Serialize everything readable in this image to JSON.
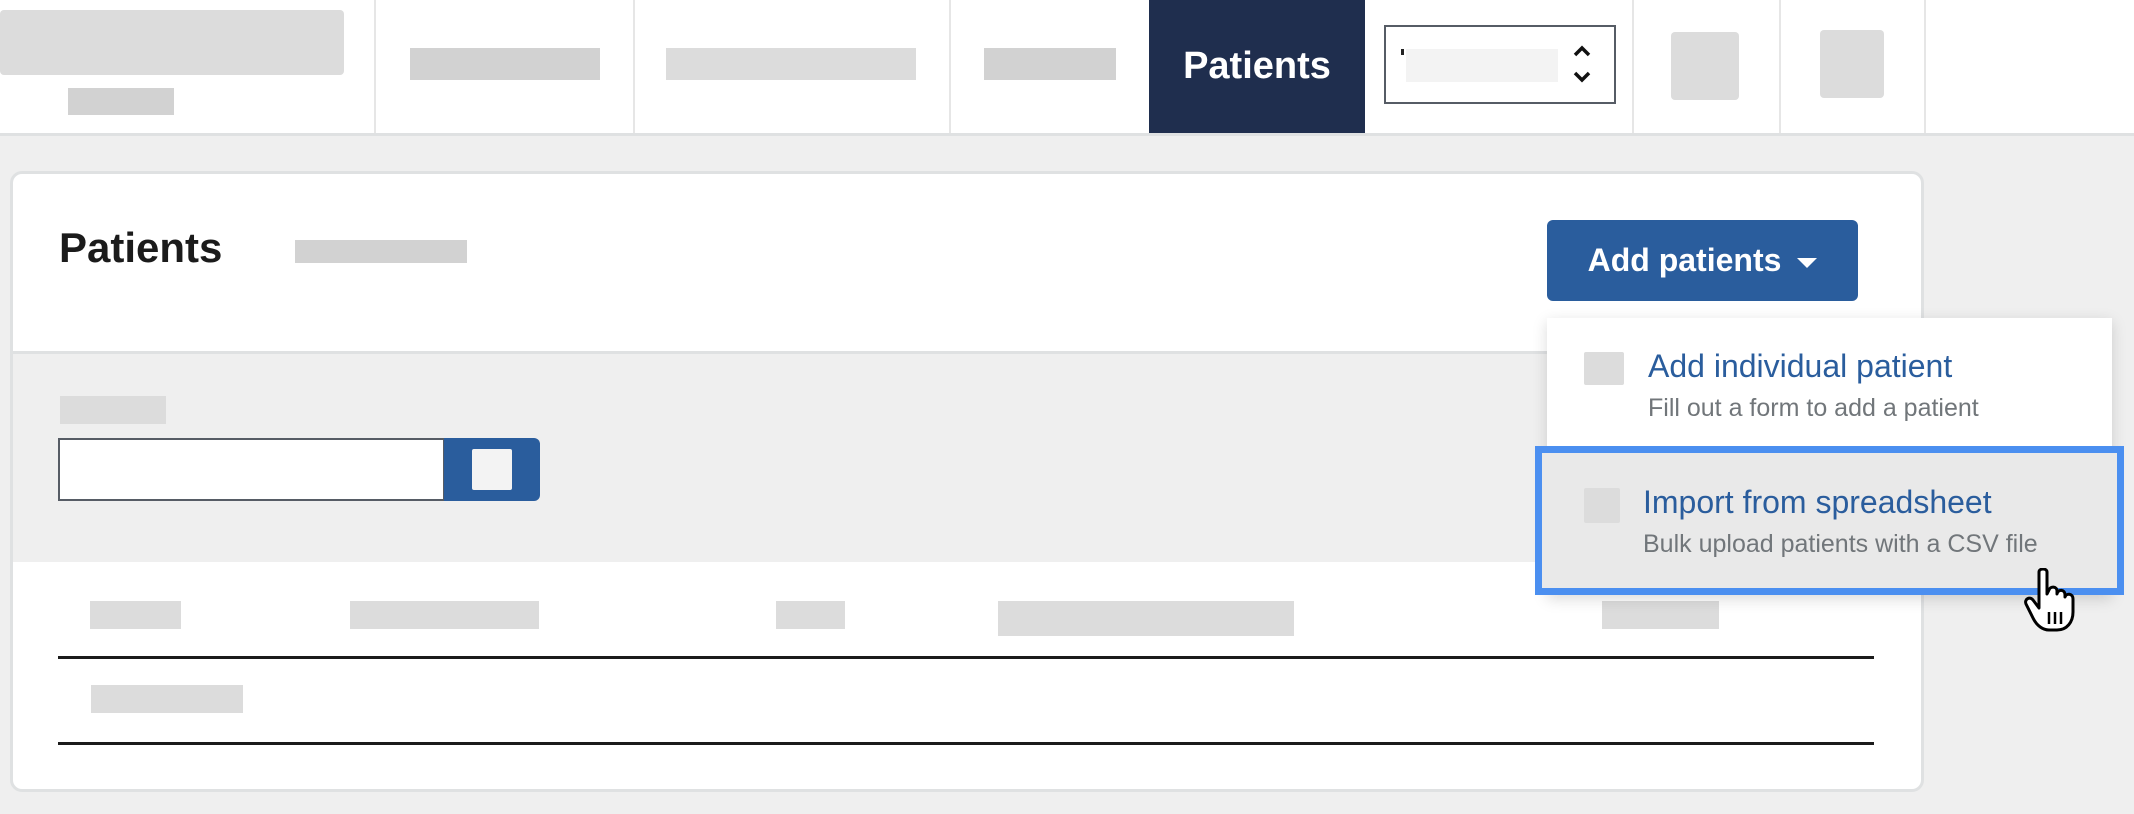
{
  "nav": {
    "active_tab_label": "Patients",
    "select": {
      "value": "",
      "icon": "up-down-chevron-icon"
    },
    "icon_buttons": [
      "icon-button-1",
      "icon-button-2"
    ]
  },
  "card": {
    "title": "Patients",
    "add_button": {
      "label": "Add patients",
      "icon": "caret-down-icon"
    },
    "search": {
      "value": "",
      "placeholder": "",
      "button_icon": "search-icon"
    },
    "table": {
      "columns": [
        "",
        "",
        "",
        "",
        ""
      ],
      "rows": [
        [
          ""
        ]
      ]
    }
  },
  "dropdown": {
    "items": [
      {
        "title": "Add individual patient",
        "description": "Fill out a form to add a patient",
        "focused": false
      },
      {
        "title": "Import from spreadsheet",
        "description": "Bulk upload patients with a CSV file",
        "focused": true
      }
    ]
  },
  "colors": {
    "primary": "#2a5d9d",
    "nav_active": "#1f2e4e",
    "focus_ring": "#4b8ff0",
    "muted_text": "#71767a"
  }
}
